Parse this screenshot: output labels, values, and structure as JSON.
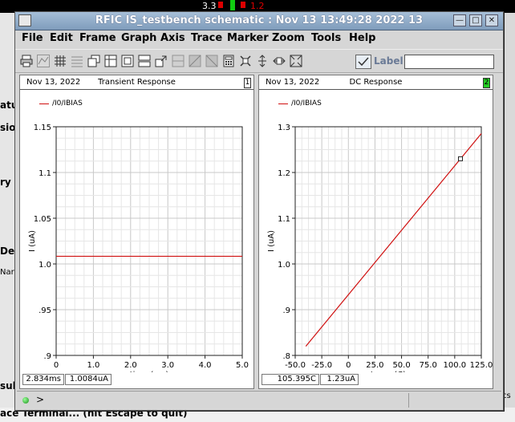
{
  "window": {
    "title": "RFIC IS_testbench schematic : Nov 13 13:49:28 2022 13"
  },
  "background": {
    "top_fragment_1": "3.3",
    "top_fragment_2": "1.2",
    "left_fragments": [
      "atu",
      "sion",
      "ry",
      "De",
      "Nar",
      "sult"
    ],
    "right_fragment": "cs",
    "bottom_fragment": "ace Terminal... (hit Escape to quit)"
  },
  "menu": [
    "File",
    "Edit",
    "Frame",
    "Graph",
    "Axis",
    "Trace",
    "Marker",
    "Zoom",
    "Tools",
    "Help"
  ],
  "toolbar": {
    "icons": [
      "print-icon",
      "trace-icon",
      "grid-icon",
      "list-icon",
      "windows-icon",
      "table-icon",
      "frame-icon",
      "split-icon",
      "resize-icon",
      "strip-icon",
      "diag-a-icon",
      "diag-b-icon",
      "calculator-icon",
      "fit-icon",
      "crosshair-v-icon",
      "crosshair-h-icon",
      "zoom-fit-icon"
    ],
    "label_text": "Label",
    "label_value": ""
  },
  "panels": [
    {
      "date": "Nov 13, 2022",
      "title": "Transient Response",
      "number": "1",
      "number_color": "#ffffff",
      "legend": "/I0/IBIAS",
      "readout_x": "2.834ms",
      "readout_y": "1.0084uA"
    },
    {
      "date": "Nov 13, 2022",
      "title": "DC Response",
      "number": "2",
      "number_color": "#22cc22",
      "legend": "/I0/IBIAS",
      "readout_x": "105.395C",
      "readout_y": "1.23uA"
    }
  ],
  "status": {
    "prompt": ">"
  },
  "chart_data": [
    {
      "type": "line",
      "title": "Transient Response",
      "xlabel": "time (ms)",
      "ylabel": "I (uA)",
      "xlim": [
        0,
        5.0
      ],
      "ylim": [
        0.9,
        1.15
      ],
      "xticks": [
        "0",
        "1.0",
        "2.0",
        "3.0",
        "4.0",
        "5.0"
      ],
      "xtick_values": [
        0,
        1.0,
        2.0,
        3.0,
        4.0,
        5.0
      ],
      "yticks": [
        ".9",
        ".95",
        "1.0",
        "1.05",
        "1.1",
        "1.15"
      ],
      "ytick_values": [
        0.9,
        0.95,
        1.0,
        1.05,
        1.1,
        1.15
      ],
      "grid": true,
      "series": [
        {
          "name": "/I0/IBIAS",
          "color": "#d01010",
          "x": [
            0,
            5.0
          ],
          "y": [
            1.0084,
            1.0084
          ]
        }
      ]
    },
    {
      "type": "line",
      "title": "DC Response",
      "xlabel": "temp (C)",
      "ylabel": "I (uA)",
      "xlim": [
        -50,
        125
      ],
      "ylim": [
        0.8,
        1.3
      ],
      "xticks": [
        "-50.0",
        "-25.0",
        "0",
        "25.0",
        "50.0",
        "75.0",
        "100.0",
        "125.0"
      ],
      "xtick_values": [
        -50,
        -25,
        0,
        25,
        50,
        75,
        100,
        125
      ],
      "yticks": [
        ".8",
        ".9",
        "1.0",
        "1.1",
        "1.2",
        "1.3"
      ],
      "ytick_values": [
        0.8,
        0.9,
        1.0,
        1.1,
        1.2,
        1.3
      ],
      "grid": true,
      "series": [
        {
          "name": "/I0/IBIAS",
          "color": "#d01010",
          "x": [
            -40,
            125
          ],
          "y": [
            0.82,
            1.285
          ]
        }
      ],
      "marker": {
        "x": 105.395,
        "y": 1.23
      }
    }
  ]
}
